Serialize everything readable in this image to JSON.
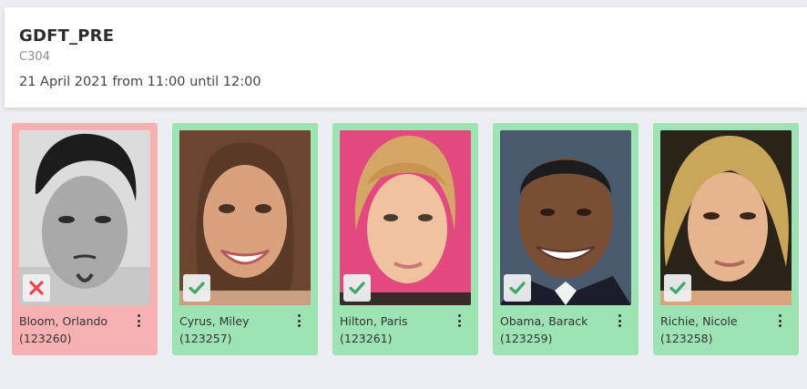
{
  "session": {
    "course": "GDFT_PRE",
    "room": "C304",
    "datetime": "21 April 2021 from 11:00 until 12:00"
  },
  "students": [
    {
      "name": "Bloom, Orlando",
      "id": "(123260)",
      "status": "absent",
      "status_icon": "cross-icon"
    },
    {
      "name": "Cyrus, Miley",
      "id": "(123257)",
      "status": "present",
      "status_icon": "check-icon"
    },
    {
      "name": "Hilton, Paris",
      "id": "(123261)",
      "status": "present",
      "status_icon": "check-icon"
    },
    {
      "name": "Obama, Barack",
      "id": "(123259)",
      "status": "present",
      "status_icon": "check-icon"
    },
    {
      "name": "Richie, Nicole",
      "id": "(123258)",
      "status": "present",
      "status_icon": "check-icon"
    }
  ],
  "colors": {
    "absent_card": "#f8b1b3",
    "present_card": "#9de3b4",
    "cross": "#e8474c",
    "check": "#3fa86a"
  }
}
